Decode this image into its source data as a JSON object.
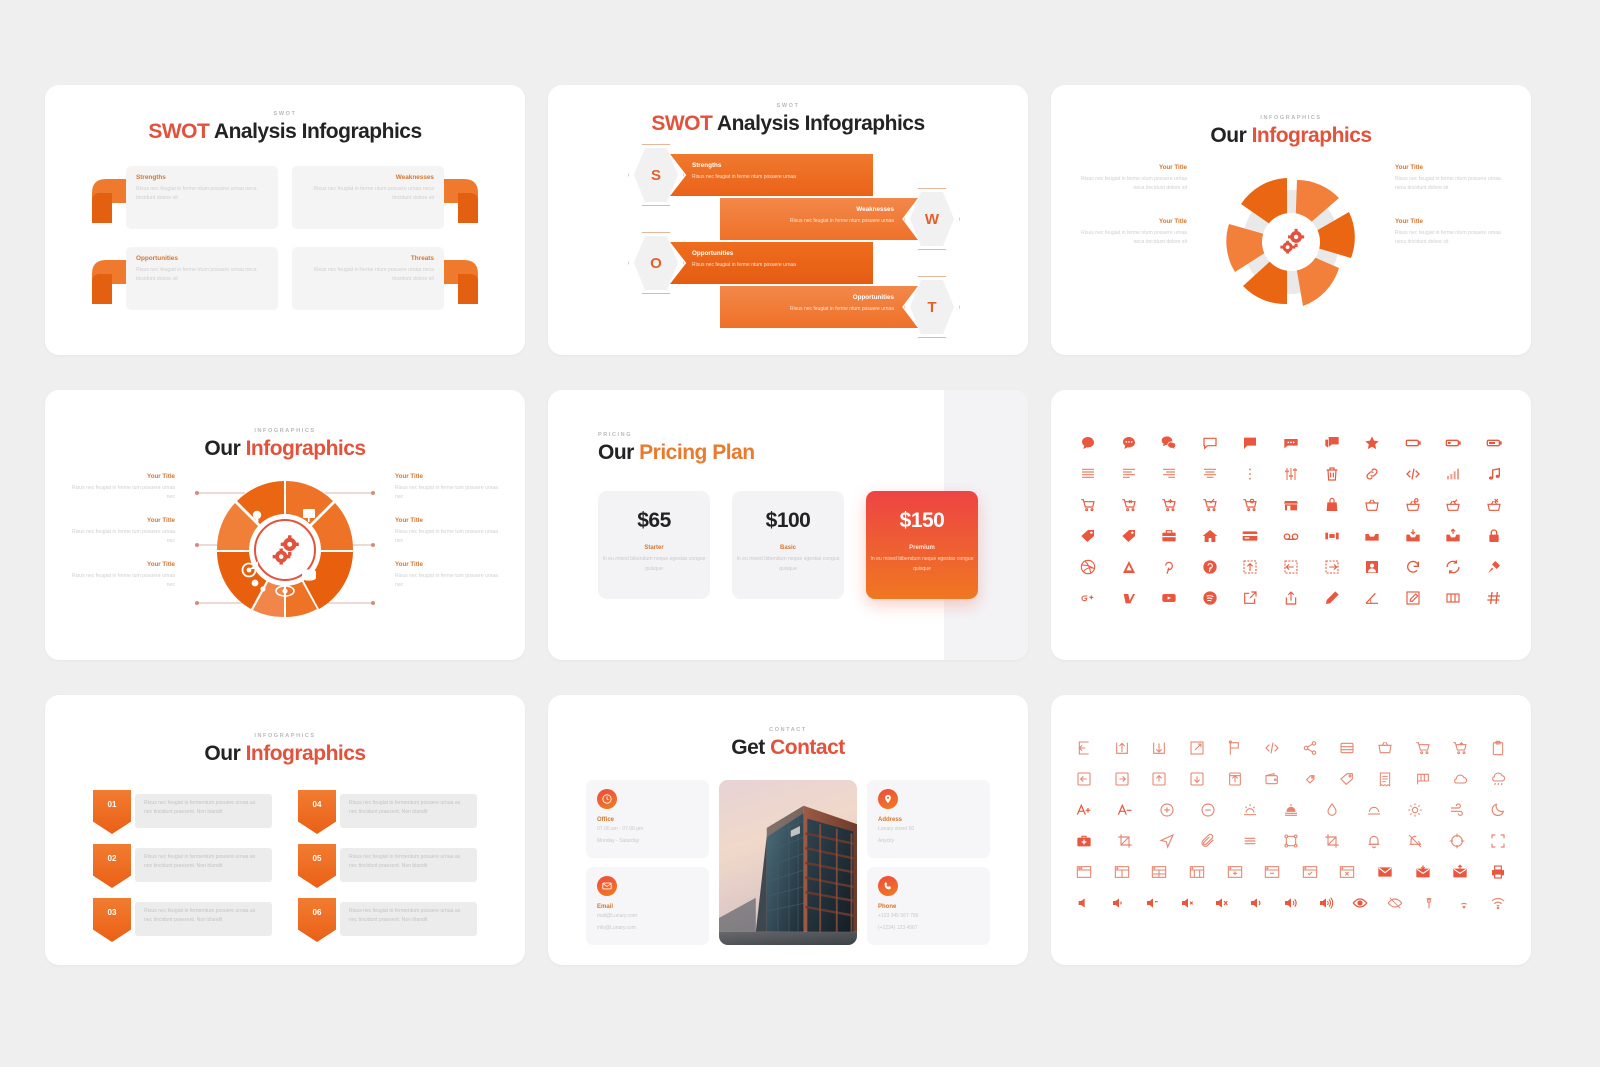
{
  "theme": {
    "canvas_bg": "#efefef",
    "card_bg": "#ffffff",
    "accent_orange": "#ea7a2c",
    "accent_red": "#e2523c",
    "accent_dark_orange": "#e45c12",
    "muted_text": "#cfcfcf",
    "title_dark": "#232323"
  },
  "lorem": {
    "swot_desc": "Risus nec feugiat in ferme ntum  posuere urnaa neca tincidunt  dolore sit",
    "ribbon_desc": "Risus nec feugiat in ferme ntum  posuere urnaa",
    "info_desc_3": "Risus nec feugiat in ferme ntum  posuere urnaa neca tincidunt  dolore sit",
    "info_desc_2": "Risus nec feugiat in ferme tum  posuere urnaa nec",
    "num_desc": "Risus nec feugiat in fermentum posuere urnaa as nec tincidunt praesent. Non blandit",
    "price_desc": "In eu mixed bibendum neque egestas congue quisque"
  },
  "slides": [
    {
      "id": "swot-arrows",
      "eyebrow": "SWOT",
      "title_accent": "SWOT",
      "title_rest": " Analysis Infographics",
      "items": [
        {
          "label": "Strengths",
          "dir": "left"
        },
        {
          "label": "Weaknesses",
          "dir": "right"
        },
        {
          "label": "Opportunities",
          "dir": "left"
        },
        {
          "label": "Threats",
          "dir": "right"
        }
      ]
    },
    {
      "id": "swot-ribbons",
      "eyebrow": "SWOT",
      "title_accent": "SWOT",
      "title_rest": " Analysis Infographics",
      "items": [
        {
          "letter": "S",
          "label": "Strengths",
          "side": "left"
        },
        {
          "letter": "W",
          "label": "Weaknesses",
          "side": "right"
        },
        {
          "letter": "O",
          "label": "Opportunities",
          "side": "left"
        },
        {
          "letter": "T",
          "label": "Opportunities",
          "side": "right"
        }
      ]
    },
    {
      "id": "infographics-radial-4",
      "eyebrow": "INFOGRAPHICS",
      "title_dark": "Our ",
      "title_accent": "Infographics",
      "left_titles": [
        "Your Title",
        "Your Title"
      ],
      "right_titles": [
        "Your Title",
        "Your Title"
      ]
    },
    {
      "id": "infographics-radial-6",
      "eyebrow": "INFOGRAPHICS",
      "title_dark": "Our ",
      "title_accent": "Infographics",
      "left_titles": [
        "Your Title",
        "Your Title",
        "Your Title"
      ],
      "right_titles": [
        "Your Title",
        "Your Title",
        "Your Title"
      ]
    },
    {
      "id": "pricing",
      "eyebrow": "PRICING",
      "title_dark": "Our ",
      "title_accent": "Pricing Plan",
      "plans": [
        {
          "price": "$65",
          "name": "Starter",
          "highlight": false
        },
        {
          "price": "$100",
          "name": "Basic",
          "highlight": false
        },
        {
          "price": "$150",
          "name": "Premium",
          "highlight": true
        }
      ]
    },
    {
      "id": "icon-sheet-solid",
      "rows": [
        [
          "chat-bubble-icon",
          "chat-dots-icon",
          "chats-icon",
          "chat-outline-icon",
          "chat-solid-icon",
          "sms-icon",
          "chat-stack-icon",
          "star-icon",
          "battery-empty-icon",
          "battery-low-icon",
          "battery-mid-icon"
        ],
        [
          "align-justify-icon",
          "align-left-icon",
          "align-right-icon",
          "align-center-icon",
          "more-vertical-icon",
          "sliders-icon",
          "trash-icon",
          "link-icon",
          "code-icon",
          "signal-icon",
          "music-note-icon"
        ],
        [
          "cart-icon",
          "cart-remove-icon",
          "cart-add-icon",
          "cart-check-icon",
          "cart-plus-icon",
          "store-icon",
          "shopping-bag-icon",
          "basket-icon",
          "basket-add-icon",
          "basket-check-icon",
          "basket-remove-icon"
        ],
        [
          "tag-icon",
          "tag-filled-icon",
          "briefcase-icon",
          "home-icon",
          "credit-card-icon",
          "voicemail-icon",
          "film-icon",
          "inbox-icon",
          "inbox-down-icon",
          "inbox-up-icon",
          "lock-icon"
        ],
        [
          "dribbble-icon",
          "behance-icon",
          "pinterest-p-icon",
          "pinterest-icon",
          "move-up-icon",
          "move-left-icon",
          "move-right-icon",
          "portrait-icon",
          "refresh-icon",
          "sync-icon",
          "plug-icon"
        ],
        [
          "google-plus-icon",
          "vimeo-icon",
          "youtube-icon",
          "spotify-icon",
          "external-link-icon",
          "upload-box-icon",
          "pencil-icon",
          "ruler-icon",
          "edit-square-icon",
          "columns-icon",
          "hash-icon"
        ]
      ]
    },
    {
      "id": "numbered-infographics",
      "eyebrow": "INFOGRAPHICS",
      "title_dark": "Our ",
      "title_accent": "Infographics",
      "left_numbers": [
        "01",
        "02",
        "03"
      ],
      "right_numbers": [
        "04",
        "05",
        "06"
      ]
    },
    {
      "id": "contact",
      "eyebrow": "CONTACT",
      "title_dark": "Get ",
      "title_accent": "Contact",
      "cards": [
        {
          "icon": "clock-icon",
          "title": "Office",
          "lines": [
            "07.00 am - 07.00 pm",
            "Monday - Saturday"
          ]
        },
        {
          "icon": "envelope-icon",
          "title": "Email",
          "lines": [
            "mail@Lunary.com",
            "info@Lunary.com"
          ]
        },
        {
          "icon": "pin-icon",
          "title": "Address",
          "lines": [
            "Lunary street 50",
            "Anycity"
          ]
        },
        {
          "icon": "phone-icon",
          "title": "Phone",
          "lines": [
            "+123 345 567 789",
            "(+1234) 123 4567"
          ]
        }
      ],
      "photo_alt": "office-building-photo"
    },
    {
      "id": "icon-sheet-outline",
      "rows": [
        [
          "login-icon",
          "arrow-up-box-icon",
          "arrow-down-box-icon",
          "expand-icon",
          "flag-icon",
          "code-icon",
          "share-icon",
          "drawer-icon",
          "basket-icon",
          "cart-icon",
          "cart-add-icon",
          "clipboard-icon"
        ],
        [
          "arrow-left-box-icon",
          "arrow-right-box-icon",
          "arrow-up-square-icon",
          "arrow-down-square-icon",
          "upload-square-icon",
          "wallet-icon",
          "tag-small-icon",
          "tag-icon",
          "receipt-icon",
          "flag-square-icon",
          "cloud-icon",
          "cloud-rain-icon"
        ],
        [
          "font-increase-icon",
          "font-decrease-icon",
          "zoom-in-icon",
          "zoom-out-icon",
          "sunrise-icon",
          "sunset-icon",
          "droplet-icon",
          "sunset-filled-icon",
          "sun-icon",
          "wind-icon",
          "moon-icon"
        ],
        [
          "first-aid-icon",
          "crop-icon",
          "navigation-icon",
          "paperclip-icon",
          "menu-icon",
          "frame-icon",
          "crop-rotate-icon",
          "bell-icon",
          "bell-off-icon",
          "target-icon",
          "fullscreen-icon"
        ],
        [
          "browser-icon",
          "browser-split-icon",
          "browser-grid-icon",
          "browser-columns-icon",
          "browser-add-icon",
          "browser-remove-icon",
          "browser-check-icon",
          "browser-close-icon",
          "mail-open-icon",
          "mail-down-icon",
          "mail-up-icon",
          "printer-icon"
        ],
        [
          "volume-mute-icon",
          "volume-low-icon",
          "volume-down-icon",
          "volume-off-icon",
          "volume-x-icon",
          "volume-mid-icon",
          "volume-high-icon",
          "volume-max-icon",
          "eye-icon",
          "eye-off-icon",
          "antenna-icon",
          "wifi-low-icon",
          "wifi-icon"
        ]
      ]
    }
  ]
}
